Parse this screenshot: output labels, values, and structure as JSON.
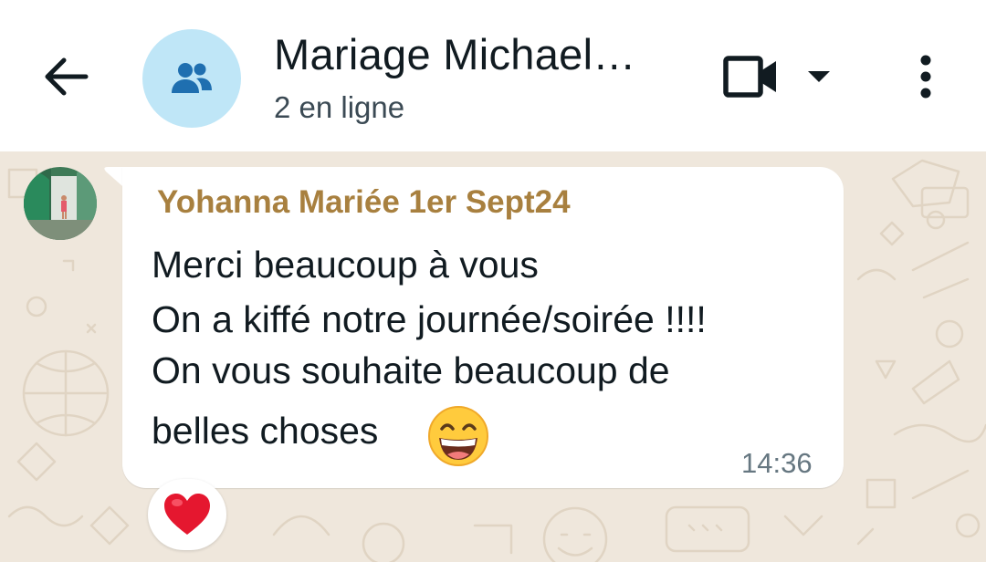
{
  "header": {
    "back_icon": "arrow-left-icon",
    "group_icon": "group-icon",
    "title": "Mariage Michael…",
    "subtitle": "2 en ligne",
    "video_icon": "video-camera-icon",
    "dropdown_icon": "caret-down-icon",
    "more_icon": "more-vertical-icon"
  },
  "message": {
    "sender": "Yohanna Mariée 1er Sept24",
    "lines": [
      "Merci beaucoup à vous",
      "On a kiffé notre journée/soirée !!!!",
      "On vous souhaite beaucoup de",
      "belles choses"
    ],
    "emoji": "grinning-face-with-smiling-eyes",
    "time": "14:36",
    "reaction": "red-heart"
  },
  "colors": {
    "header_bg": "#ffffff",
    "chat_bg": "#efe7dc",
    "avatar_bg": "#bfe6f7",
    "group_icon": "#1f6fb0",
    "sender_name": "#a8803f",
    "message_text": "#111b21",
    "time_text": "#667781",
    "heart": "#e5172f"
  }
}
